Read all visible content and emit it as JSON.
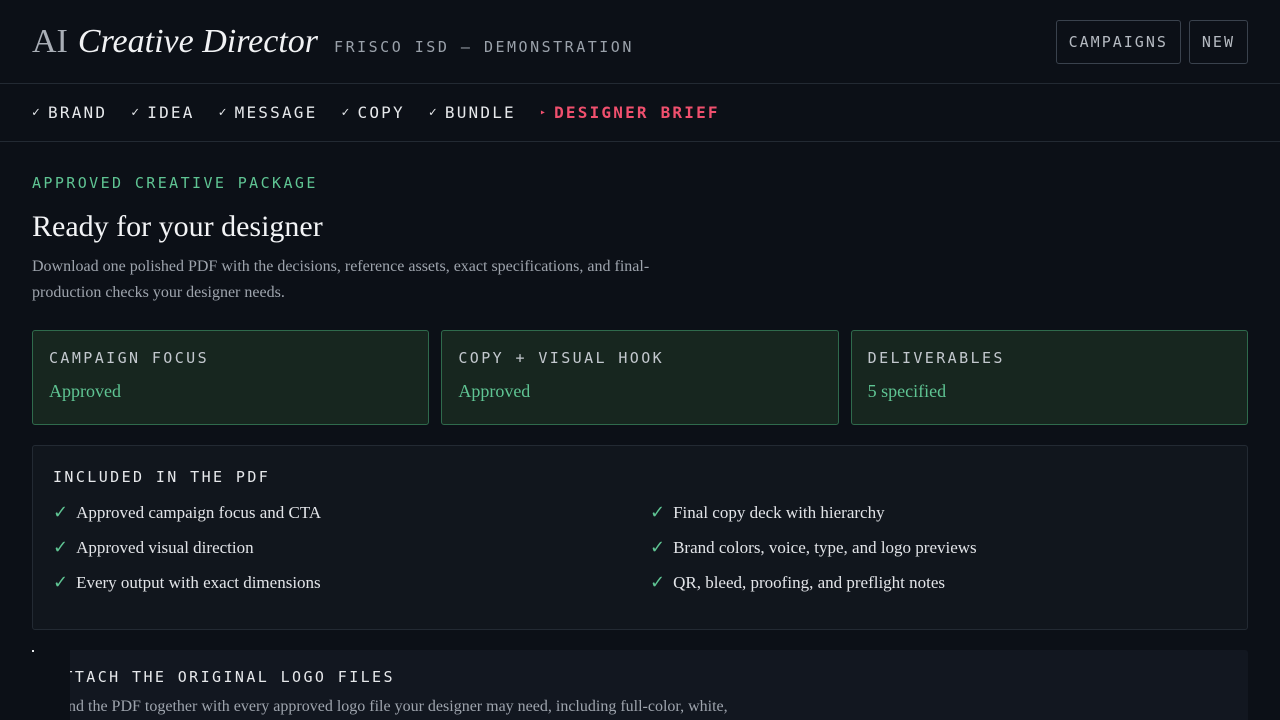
{
  "header": {
    "brand_ai": "AI",
    "brand_name": "Creative Director",
    "subtitle": "FRISCO ISD — DEMONSTRATION",
    "actions": {
      "campaigns": "CAMPAIGNS",
      "new": "NEW"
    }
  },
  "steps": [
    {
      "label": "BRAND",
      "mark": "✓"
    },
    {
      "label": "IDEA",
      "mark": "✓"
    },
    {
      "label": "MESSAGE",
      "mark": "✓"
    },
    {
      "label": "COPY",
      "mark": "✓"
    },
    {
      "label": "BUNDLE",
      "mark": "✓"
    },
    {
      "label": "DESIGNER BRIEF",
      "mark": "▸"
    }
  ],
  "main": {
    "eyebrow": "APPROVED CREATIVE PACKAGE",
    "title": "Ready for your designer",
    "description": "Download one polished PDF with the decisions, reference assets, exact specifications, and final-production checks your designer needs."
  },
  "cards": [
    {
      "label": "CAMPAIGN FOCUS",
      "value": "Approved"
    },
    {
      "label": "COPY + VISUAL HOOK",
      "value": "Approved"
    },
    {
      "label": "DELIVERABLES",
      "value": "5 specified"
    }
  ],
  "included": {
    "title": "INCLUDED IN THE PDF",
    "tick": "✓",
    "items": [
      "Approved campaign focus and CTA",
      "Final copy deck with hierarchy",
      "Approved visual direction",
      "Brand colors, voice, type, and logo previews",
      "Every output with exact dimensions",
      "QR, bleed, proofing, and preflight notes"
    ]
  },
  "logos": {
    "title": "ATTACH THE ORIGINAL LOGO FILES",
    "description": "Send the PDF together with every approved logo file your designer may need, including full-color, white,"
  },
  "colors": {
    "background": "#0c1017",
    "accent_green": "#5fc493",
    "accent_red": "#f0506e"
  }
}
